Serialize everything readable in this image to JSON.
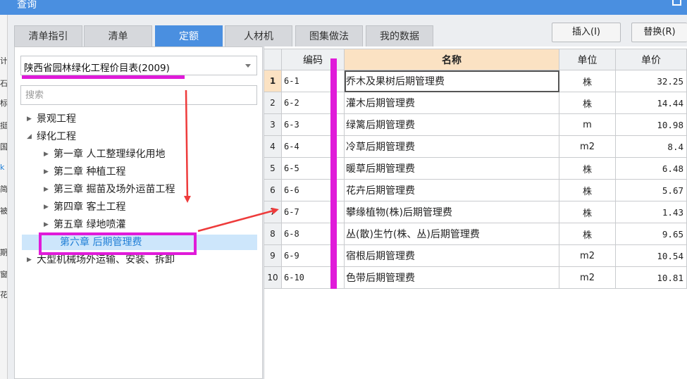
{
  "window": {
    "title": "查询"
  },
  "background_chars": [
    "计",
    "石",
    "标",
    "挺",
    "国",
    "k",
    "简",
    "被",
    "",
    "期",
    "窗",
    "花"
  ],
  "tabs": [
    {
      "label": "清单指引"
    },
    {
      "label": "清单"
    },
    {
      "label": "定额"
    },
    {
      "label": "人材机"
    },
    {
      "label": "图集做法"
    },
    {
      "label": "我的数据"
    }
  ],
  "buttons": {
    "insert": "插入(I)",
    "replace": "替换(R)"
  },
  "library_select": {
    "value": "陕西省园林绿化工程价目表(2009)"
  },
  "search": {
    "placeholder": "搜索"
  },
  "tree": [
    {
      "label": "景观工程"
    },
    {
      "label": "绿化工程"
    },
    {
      "label": "第一章 人工整理绿化用地"
    },
    {
      "label": "第二章 种植工程"
    },
    {
      "label": "第三章 掘苗及场外运苗工程"
    },
    {
      "label": "第四章 客土工程"
    },
    {
      "label": "第五章 绿地喷灌"
    },
    {
      "label": "第六章 后期管理费"
    },
    {
      "label": "大型机械场外运输、安装、拆卸"
    }
  ],
  "table": {
    "headers": {
      "code": "编码",
      "name": "名称",
      "unit": "单位",
      "price": "单价"
    },
    "rows": [
      {
        "n": "1",
        "code": "6-1",
        "name": "乔木及果树后期管理费",
        "unit": "株",
        "price": "32.25"
      },
      {
        "n": "2",
        "code": "6-2",
        "name": "灌木后期管理费",
        "unit": "株",
        "price": "14.44"
      },
      {
        "n": "3",
        "code": "6-3",
        "name": "绿篱后期管理费",
        "unit": "m",
        "price": "10.98"
      },
      {
        "n": "4",
        "code": "6-4",
        "name": "冷草后期管理费",
        "unit": "m2",
        "price": "8.4"
      },
      {
        "n": "5",
        "code": "6-5",
        "name": "暖草后期管理费",
        "unit": "株",
        "price": "6.48"
      },
      {
        "n": "6",
        "code": "6-6",
        "name": "花卉后期管理费",
        "unit": "株",
        "price": "5.67"
      },
      {
        "n": "7",
        "code": "6-7",
        "name": "攀缘植物(株)后期管理费",
        "unit": "株",
        "price": "1.43"
      },
      {
        "n": "8",
        "code": "6-8",
        "name": "丛(散)生竹(株、丛)后期管理费",
        "unit": "株",
        "price": "9.65"
      },
      {
        "n": "9",
        "code": "6-9",
        "name": "宿根后期管理费",
        "unit": "m2",
        "price": "10.54"
      },
      {
        "n": "10",
        "code": "6-10",
        "name": "色带后期管理费",
        "unit": "m2",
        "price": "10.81"
      }
    ]
  },
  "colors": {
    "accent": "#4a8fe0",
    "annotation": "#e01bd9",
    "arrow": "#ee3b3b",
    "selected_tree_bg": "#cde6fb"
  }
}
